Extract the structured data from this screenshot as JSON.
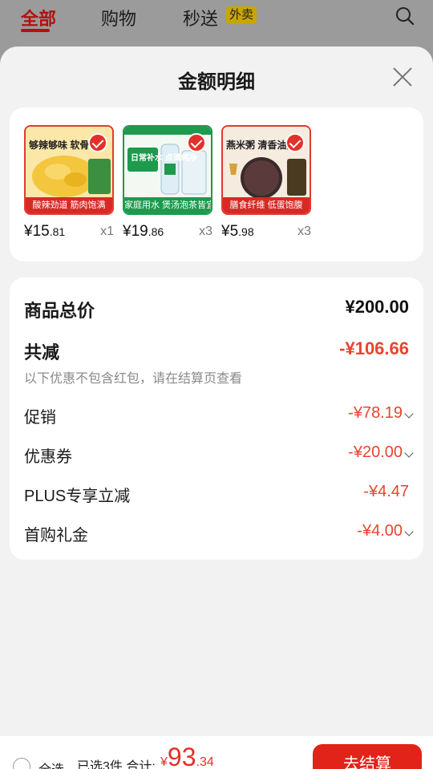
{
  "topbar": {
    "tabs": [
      {
        "label": "全部",
        "active": true
      },
      {
        "label": "购物",
        "active": false
      },
      {
        "label": "秒送",
        "active": false
      }
    ],
    "badge": "外卖",
    "search_icon": "search-icon"
  },
  "modal": {
    "title": "金额明细",
    "close_icon": "close-icon",
    "products": [
      {
        "title": "够辣够味 软骨",
        "tag": "酸辣劲道 筋肉饱满",
        "price_int": "¥15",
        "price_dec": ".81",
        "qty": "x1",
        "thumb_color": "#f3c948"
      },
      {
        "title": "日常补水 点滴纯净",
        "tag": "家庭用水 煲汤泡茶皆宜",
        "price_int": "¥19",
        "price_dec": ".86",
        "qty": "x3",
        "thumb_color": "#e9f3ea"
      },
      {
        "title": "燕米粥 清香油亮",
        "tag": "膳食纤维 低蛋饱腹",
        "price_int": "¥5",
        "price_dec": ".98",
        "qty": "x3",
        "thumb_color": "#f6eadf"
      }
    ],
    "detail": {
      "total_label": "商品总价",
      "total_value": "¥200.00",
      "reduce_label": "共减",
      "reduce_value": "-¥106.66",
      "reduce_note": "以下优惠不包含红包，请在结算页查看",
      "items": [
        {
          "label": "促销",
          "value": "-¥78.19",
          "expandable": true
        },
        {
          "label": "优惠券",
          "value": "-¥20.00",
          "expandable": true
        },
        {
          "label": "PLUS专享立减",
          "value": "-¥4.47",
          "expandable": false
        },
        {
          "label": "首购礼金",
          "value": "-¥4.00",
          "expandable": true
        }
      ]
    }
  },
  "bottombar": {
    "select_all": "全选",
    "summary": "已选3件,合计:",
    "currency": "¥",
    "total_int": "93",
    "total_dec": ".34",
    "checkout": "去结算"
  },
  "colors": {
    "accent": "#e2312b",
    "discount": "#e8442e"
  }
}
